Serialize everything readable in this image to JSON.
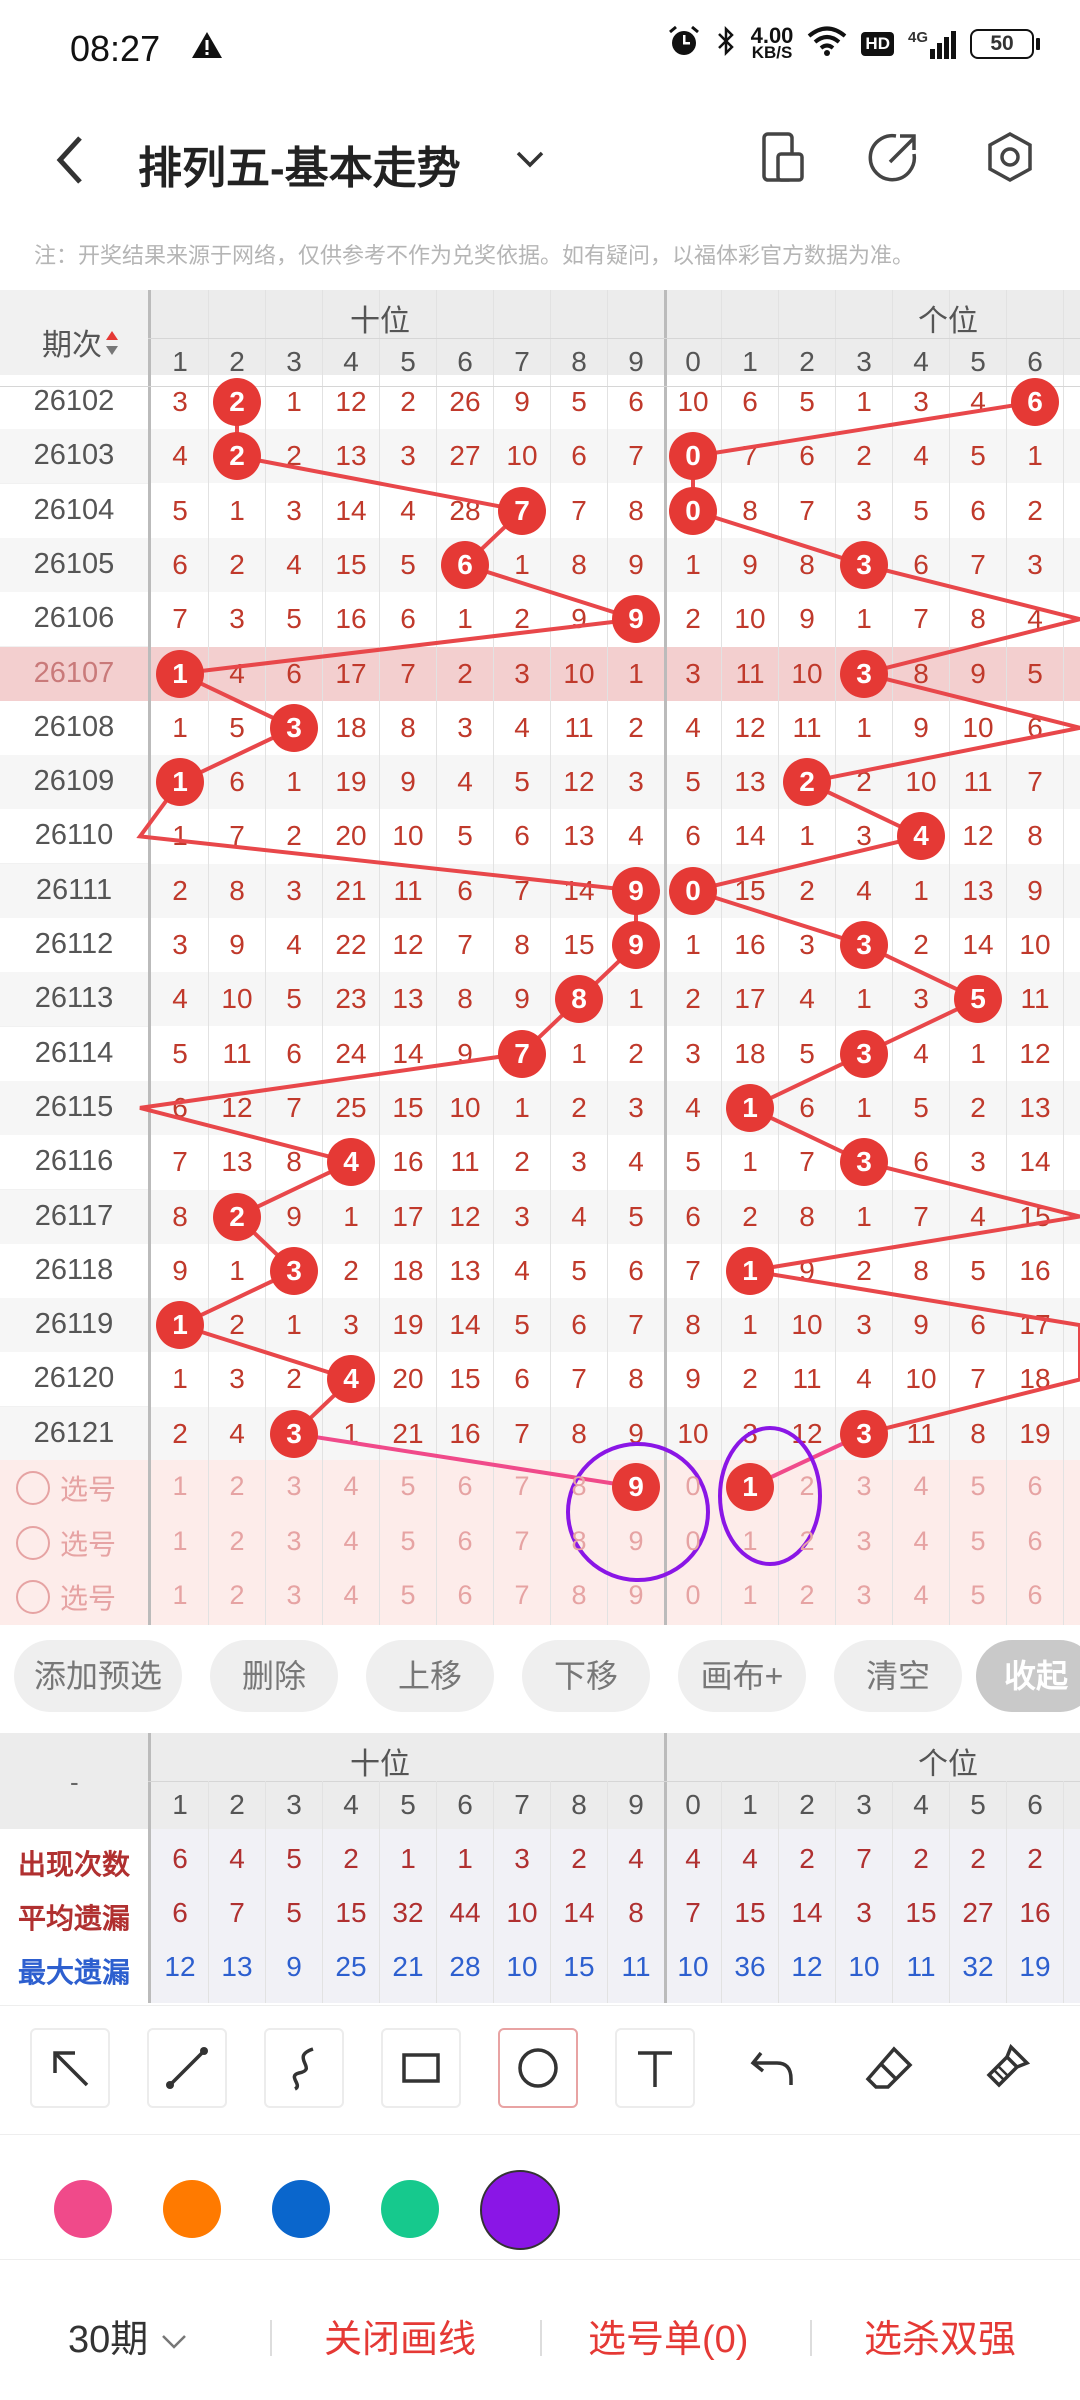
{
  "status_bar": {
    "time": "08:27",
    "net_speed_value": "4.00",
    "net_speed_unit": "KB/S",
    "battery": "50",
    "hd": "HD",
    "signal": "4G"
  },
  "header": {
    "title": "排列五-基本走势"
  },
  "note": "注：开奖结果来源于网络，仅供参考不作为兑奖依据。如有疑问，以福体彩官方数据为准。",
  "chart": {
    "period_header": "期次",
    "group_tens": "十位",
    "group_units": "个位",
    "tens_numbers": [
      "1",
      "2",
      "3",
      "4",
      "5",
      "6",
      "7",
      "8",
      "9"
    ],
    "units_numbers": [
      "0",
      "1",
      "2",
      "3",
      "4",
      "5",
      "6"
    ],
    "rows": [
      {
        "period": "26102",
        "tens": [
          "3",
          "2",
          "1",
          "12",
          "2",
          "26",
          "9",
          "5",
          "6"
        ],
        "units": [
          "10",
          "6",
          "5",
          "1",
          "3",
          "4",
          "6"
        ],
        "tens_hit": 2,
        "units_hit": 6
      },
      {
        "period": "26103",
        "tens": [
          "4",
          "2",
          "2",
          "13",
          "3",
          "27",
          "10",
          "6",
          "7"
        ],
        "units": [
          "0",
          "7",
          "6",
          "2",
          "4",
          "5",
          "1"
        ],
        "tens_hit": 2,
        "units_hit": 0
      },
      {
        "period": "26104",
        "tens": [
          "5",
          "1",
          "3",
          "14",
          "4",
          "28",
          "7",
          "7",
          "8"
        ],
        "units": [
          "0",
          "8",
          "7",
          "3",
          "5",
          "6",
          "2"
        ],
        "tens_hit": 7,
        "units_hit": 0
      },
      {
        "period": "26105",
        "tens": [
          "6",
          "2",
          "4",
          "15",
          "5",
          "6",
          "1",
          "8",
          "9"
        ],
        "units": [
          "1",
          "9",
          "8",
          "3",
          "6",
          "7",
          "3"
        ],
        "tens_hit": 6,
        "units_hit": 3
      },
      {
        "period": "26106",
        "tens": [
          "7",
          "3",
          "5",
          "16",
          "6",
          "1",
          "2",
          "9",
          "9"
        ],
        "units": [
          "2",
          "10",
          "9",
          "1",
          "7",
          "8",
          "4"
        ],
        "tens_hit": 9,
        "units_hit": -1
      },
      {
        "period": "26107",
        "tens": [
          "1",
          "4",
          "6",
          "17",
          "7",
          "2",
          "3",
          "10",
          "1"
        ],
        "units": [
          "3",
          "11",
          "10",
          "3",
          "8",
          "9",
          "5"
        ],
        "tens_hit": 1,
        "units_hit": 3
      },
      {
        "period": "26108",
        "tens": [
          "1",
          "5",
          "3",
          "18",
          "8",
          "3",
          "4",
          "11",
          "2"
        ],
        "units": [
          "4",
          "12",
          "11",
          "1",
          "9",
          "10",
          "6"
        ],
        "tens_hit": 3,
        "units_hit": -1
      },
      {
        "period": "26109",
        "tens": [
          "1",
          "6",
          "1",
          "19",
          "9",
          "4",
          "5",
          "12",
          "3"
        ],
        "units": [
          "5",
          "13",
          "2",
          "2",
          "10",
          "11",
          "7"
        ],
        "tens_hit": 1,
        "units_hit": 2
      },
      {
        "period": "26110",
        "tens": [
          "1",
          "7",
          "2",
          "20",
          "10",
          "5",
          "6",
          "13",
          "4"
        ],
        "units": [
          "6",
          "14",
          "1",
          "3",
          "4",
          "12",
          "8"
        ],
        "tens_hit": -1,
        "units_hit": 4
      },
      {
        "period": "26111",
        "tens": [
          "2",
          "8",
          "3",
          "21",
          "11",
          "6",
          "7",
          "14",
          "9"
        ],
        "units": [
          "0",
          "15",
          "2",
          "4",
          "1",
          "13",
          "9"
        ],
        "tens_hit": 9,
        "units_hit": 0
      },
      {
        "period": "26112",
        "tens": [
          "3",
          "9",
          "4",
          "22",
          "12",
          "7",
          "8",
          "15",
          "9"
        ],
        "units": [
          "1",
          "16",
          "3",
          "3",
          "2",
          "14",
          "10"
        ],
        "tens_hit": 9,
        "units_hit": 3
      },
      {
        "period": "26113",
        "tens": [
          "4",
          "10",
          "5",
          "23",
          "13",
          "8",
          "9",
          "8",
          "1"
        ],
        "units": [
          "2",
          "17",
          "4",
          "1",
          "3",
          "5",
          "11"
        ],
        "tens_hit": 8,
        "units_hit": 5
      },
      {
        "period": "26114",
        "tens": [
          "5",
          "11",
          "6",
          "24",
          "14",
          "9",
          "7",
          "1",
          "2"
        ],
        "units": [
          "3",
          "18",
          "5",
          "3",
          "4",
          "1",
          "12"
        ],
        "tens_hit": 7,
        "units_hit": 3
      },
      {
        "period": "26115",
        "tens": [
          "6",
          "12",
          "7",
          "25",
          "15",
          "10",
          "1",
          "2",
          "3"
        ],
        "units": [
          "4",
          "1",
          "6",
          "1",
          "5",
          "2",
          "13"
        ],
        "tens_hit": -1,
        "units_hit": 1
      },
      {
        "period": "26116",
        "tens": [
          "7",
          "13",
          "8",
          "4",
          "16",
          "11",
          "2",
          "3",
          "4"
        ],
        "units": [
          "5",
          "1",
          "7",
          "3",
          "6",
          "3",
          "14"
        ],
        "tens_hit": 4,
        "units_hit": 3
      },
      {
        "period": "26117",
        "tens": [
          "8",
          "2",
          "9",
          "1",
          "17",
          "12",
          "3",
          "4",
          "5"
        ],
        "units": [
          "6",
          "2",
          "8",
          "1",
          "7",
          "4",
          "15"
        ],
        "tens_hit": 2,
        "units_hit": -1
      },
      {
        "period": "26118",
        "tens": [
          "9",
          "1",
          "3",
          "2",
          "18",
          "13",
          "4",
          "5",
          "6"
        ],
        "units": [
          "7",
          "1",
          "9",
          "2",
          "8",
          "5",
          "16"
        ],
        "tens_hit": 3,
        "units_hit": 1
      },
      {
        "period": "26119",
        "tens": [
          "1",
          "2",
          "1",
          "3",
          "19",
          "14",
          "5",
          "6",
          "7"
        ],
        "units": [
          "8",
          "1",
          "10",
          "3",
          "9",
          "6",
          "17"
        ],
        "tens_hit": 1,
        "units_hit": -1
      },
      {
        "period": "26120",
        "tens": [
          "1",
          "3",
          "2",
          "4",
          "20",
          "15",
          "6",
          "7",
          "8"
        ],
        "units": [
          "9",
          "2",
          "11",
          "4",
          "10",
          "7",
          "18"
        ],
        "tens_hit": 4,
        "units_hit": -1
      },
      {
        "period": "26121",
        "tens": [
          "2",
          "4",
          "3",
          "1",
          "21",
          "16",
          "7",
          "8",
          "9"
        ],
        "units": [
          "10",
          "3",
          "12",
          "3",
          "11",
          "8",
          "19"
        ],
        "tens_hit": 3,
        "units_hit": 3
      }
    ],
    "pick_label": "选号",
    "pick_rows": [
      {
        "tens": [
          "1",
          "2",
          "3",
          "4",
          "5",
          "6",
          "7",
          "8",
          "9"
        ],
        "units": [
          "0",
          "1",
          "2",
          "3",
          "4",
          "5",
          "6"
        ]
      },
      {
        "tens": [
          "1",
          "2",
          "3",
          "4",
          "5",
          "6",
          "7",
          "8",
          "9"
        ],
        "units": [
          "0",
          "1",
          "2",
          "3",
          "4",
          "5",
          "6"
        ]
      },
      {
        "tens": [
          "1",
          "2",
          "3",
          "4",
          "5",
          "6",
          "7",
          "8",
          "9"
        ],
        "units": [
          "0",
          "1",
          "2",
          "3",
          "4",
          "5",
          "6"
        ]
      }
    ],
    "pick_selected": {
      "tens": "9",
      "units": "1"
    }
  },
  "actions": [
    "添加预选",
    "删除",
    "上移",
    "下移",
    "画布+",
    "清空",
    "收起"
  ],
  "stats": {
    "labels": [
      "出现次数",
      "平均遗漏",
      "最大遗漏"
    ],
    "rows": [
      {
        "tens": [
          "6",
          "4",
          "5",
          "2",
          "1",
          "1",
          "3",
          "2",
          "4"
        ],
        "units": [
          "4",
          "4",
          "2",
          "7",
          "2",
          "2",
          "2"
        ]
      },
      {
        "tens": [
          "6",
          "7",
          "5",
          "15",
          "32",
          "44",
          "10",
          "14",
          "8"
        ],
        "units": [
          "7",
          "15",
          "14",
          "3",
          "15",
          "27",
          "16"
        ]
      },
      {
        "tens": [
          "12",
          "13",
          "9",
          "25",
          "21",
          "28",
          "10",
          "15",
          "11"
        ],
        "units": [
          "10",
          "36",
          "12",
          "10",
          "11",
          "32",
          "19"
        ]
      }
    ],
    "dash": "-"
  },
  "tools": [
    "arrow-tool",
    "line-tool",
    "curve-tool",
    "rect-tool",
    "circle-tool",
    "text-tool",
    "undo-tool",
    "eraser-tool",
    "clear-tool"
  ],
  "colors": [
    "#f04a8a",
    "#ff7a00",
    "#0a66cc",
    "#16c98d",
    "#8a16e6"
  ],
  "bottom": {
    "period_select": "30期",
    "close_draw": "关闭画线",
    "pick_list": "选号单(0)",
    "kill": "选杀双强"
  }
}
